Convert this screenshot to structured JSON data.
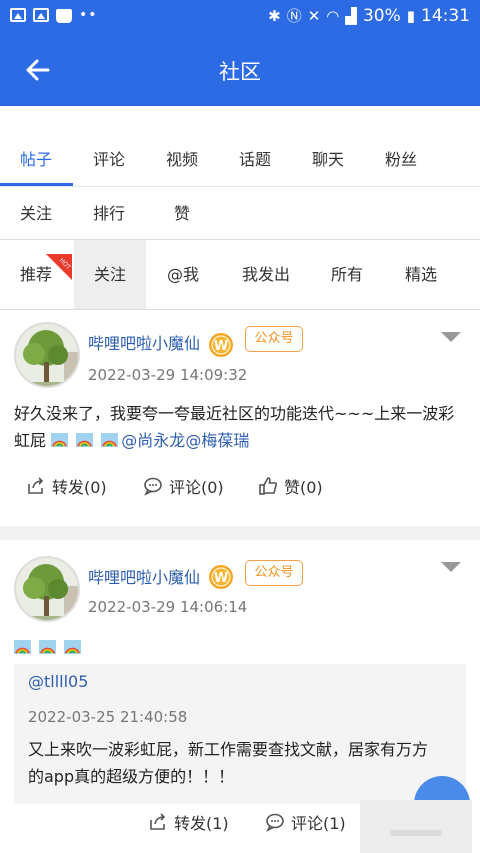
{
  "statusbar": {
    "battery": "30%",
    "time": "14:31",
    "dots": "••"
  },
  "appbar": {
    "title": "社区"
  },
  "tabs_primary": [
    "帖子",
    "评论",
    "视频",
    "话题",
    "聊天",
    "粉丝",
    "关注",
    "排行",
    "赞"
  ],
  "tabs_primary_active": "帖子",
  "tabs_secondary": [
    "推荐",
    "关注",
    "@我",
    "我发出",
    "所有",
    "精选"
  ],
  "tabs_secondary_selected": "关注",
  "hot_badge": "HOT",
  "posts": [
    {
      "author": "哔哩吧啦小魔仙",
      "tag": "公众号",
      "time": "2022-03-29 14:09:32",
      "text_line1": "好久没来了，我要夸一夸最近社区的功能迭代~~~上来一波彩",
      "text_line2_prefix": "虹屁",
      "mention1": "@尚永龙",
      "mention2": "@梅葆瑞",
      "actions": {
        "share": "转发(0)",
        "comment": "评论(0)",
        "like": "赞(0)"
      }
    },
    {
      "author": "哔哩吧啦小魔仙",
      "tag": "公众号",
      "time": "2022-03-29 14:06:14",
      "quote": {
        "user": "@tllll05",
        "time": "2022-03-25 21:40:58",
        "text_line1": "又上来吹一波彩虹屁，新工作需要查找文献，居家有万方",
        "text_line2": "的app真的超级方便的！！！"
      },
      "actions": {
        "share": "转发(1)",
        "comment": "评论(1)"
      }
    }
  ],
  "colors": {
    "primary": "#2d6be4",
    "link": "#2d5fb0",
    "tag": "#f2901c"
  }
}
